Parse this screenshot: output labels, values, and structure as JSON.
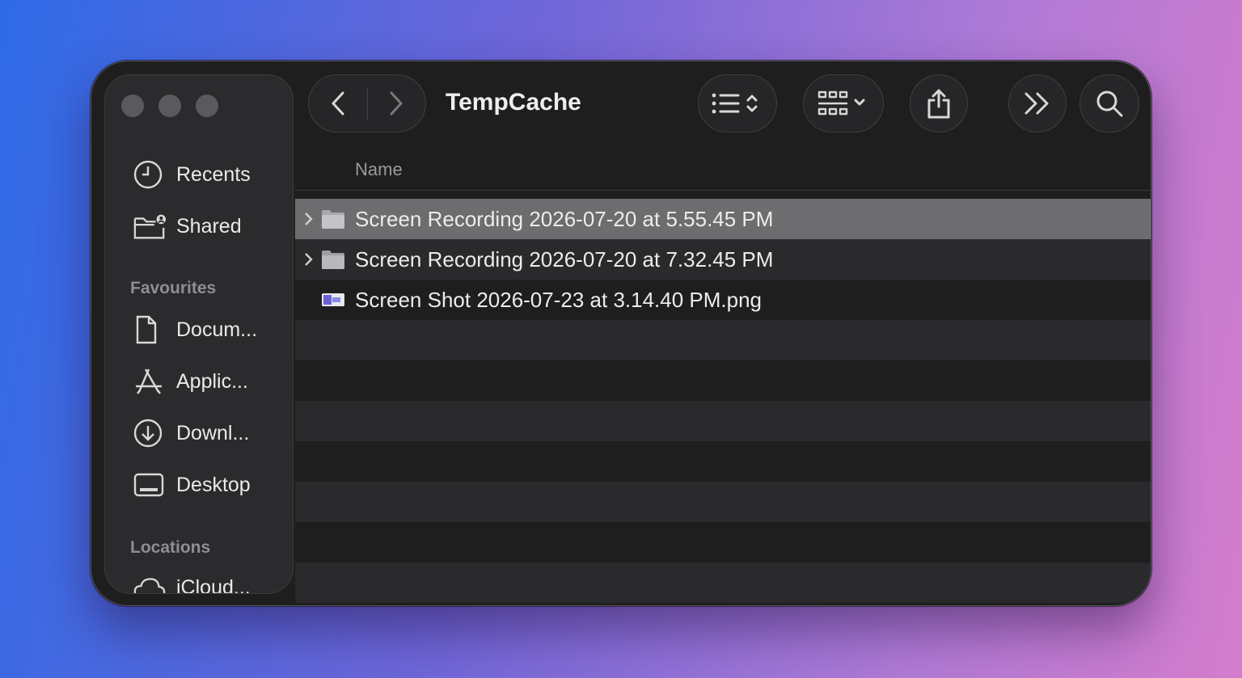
{
  "window": {
    "title": "TempCache"
  },
  "sidebar": {
    "recents": "Recents",
    "shared": "Shared",
    "favourites_heading": "Favourites",
    "favourites": [
      {
        "label": "Docum...",
        "icon": "document-icon"
      },
      {
        "label": "Applic...",
        "icon": "applications-icon"
      },
      {
        "label": "Downl...",
        "icon": "downloads-icon"
      },
      {
        "label": "Desktop",
        "icon": "desktop-icon"
      }
    ],
    "locations_heading": "Locations",
    "locations": [
      {
        "label": "iCloud...",
        "icon": "icloud-icon"
      }
    ]
  },
  "toolbar": {
    "back_icon": "chevron-left-icon",
    "forward_icon": "chevron-right-icon",
    "view_icon": "list-view-icon",
    "group_icon": "grid-group-icon",
    "share_icon": "share-icon",
    "more_icon": "double-chevron-icon",
    "search_icon": "search-icon"
  },
  "list": {
    "column_name": "Name",
    "rows": [
      {
        "name": "Screen Recording 2026-07-20 at 5.55.45 PM",
        "kind": "folder",
        "selected": true
      },
      {
        "name": "Screen Recording 2026-07-20 at 7.32.45 PM",
        "kind": "folder",
        "selected": false
      },
      {
        "name": "Screen Shot 2026-07-23 at 3.14.40 PM.png",
        "kind": "image",
        "selected": false
      }
    ]
  },
  "colors": {
    "window_bg": "#1e1e1e",
    "sidebar_bg": "#2b2b2d",
    "selection": "#6d6d6f",
    "text": "#ececec",
    "muted": "#8e8e93"
  }
}
